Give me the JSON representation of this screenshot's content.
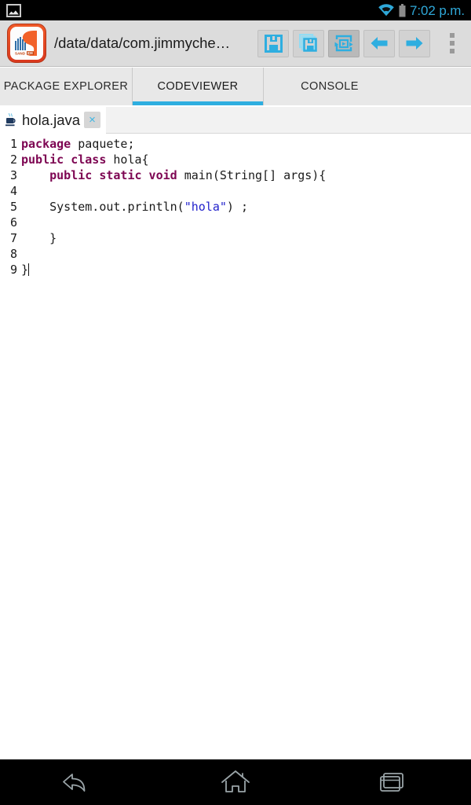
{
  "statusbar": {
    "notification_icon": "image-notification-icon",
    "wifi_icon": "wifi-icon",
    "battery_icon": "battery-icon",
    "time": "7:02 p.m.",
    "accent_color": "#2fa8d8"
  },
  "toolbar": {
    "app_icon": "sand-ide-logo",
    "app_logo_text": "SAND IDE",
    "path": "/data/data/com.jimmyche…",
    "buttons": [
      {
        "name": "save-button",
        "icon": "save-floppy-icon",
        "pressed": false
      },
      {
        "name": "save-all-button",
        "icon": "save-all-floppy-icon",
        "pressed": false
      },
      {
        "name": "run-button",
        "icon": "run-execute-icon",
        "pressed": true
      },
      {
        "name": "back-button",
        "icon": "arrow-left-icon",
        "pressed": false
      },
      {
        "name": "forward-button",
        "icon": "arrow-right-icon",
        "pressed": false
      }
    ],
    "overflow_icon": "overflow-menu-icon",
    "icon_color": "#2eaee0"
  },
  "tabs": {
    "items": [
      {
        "label": "PACKAGE EXPLORER",
        "selected": false
      },
      {
        "label": "CODEVIEWER",
        "selected": true
      },
      {
        "label": "CONSOLE",
        "selected": false
      }
    ],
    "indicator_color": "#2eaee0"
  },
  "file_tab": {
    "icon": "java-file-icon",
    "name": "hola.java",
    "close_label": "×"
  },
  "editor": {
    "keyword_color": "#7d0552",
    "string_color": "#2222cc",
    "lines": [
      {
        "n": "1",
        "segments": [
          {
            "t": "package",
            "c": "kw"
          },
          {
            "t": " paquete;",
            "c": ""
          }
        ]
      },
      {
        "n": "2",
        "segments": [
          {
            "t": "public class",
            "c": "kw"
          },
          {
            "t": " hola{",
            "c": ""
          }
        ]
      },
      {
        "n": "3",
        "segments": [
          {
            "t": "    ",
            "c": ""
          },
          {
            "t": "public static void",
            "c": "kw"
          },
          {
            "t": " main(String[] args){",
            "c": ""
          }
        ]
      },
      {
        "n": "4",
        "segments": [
          {
            "t": "",
            "c": ""
          }
        ]
      },
      {
        "n": "5",
        "segments": [
          {
            "t": "    System.out.println(",
            "c": ""
          },
          {
            "t": "\"hola\"",
            "c": "str"
          },
          {
            "t": ") ;",
            "c": ""
          }
        ]
      },
      {
        "n": "6",
        "segments": [
          {
            "t": "",
            "c": ""
          }
        ]
      },
      {
        "n": "7",
        "segments": [
          {
            "t": "    }",
            "c": ""
          }
        ]
      },
      {
        "n": "8",
        "segments": [
          {
            "t": "",
            "c": ""
          }
        ]
      },
      {
        "n": "9",
        "segments": [
          {
            "t": "}",
            "c": ""
          }
        ],
        "caret": true
      }
    ]
  },
  "navbar": {
    "buttons": [
      {
        "name": "nav-back-button",
        "icon": "back-arrow-icon"
      },
      {
        "name": "nav-home-button",
        "icon": "home-icon"
      },
      {
        "name": "nav-recents-button",
        "icon": "recents-icon"
      }
    ]
  }
}
